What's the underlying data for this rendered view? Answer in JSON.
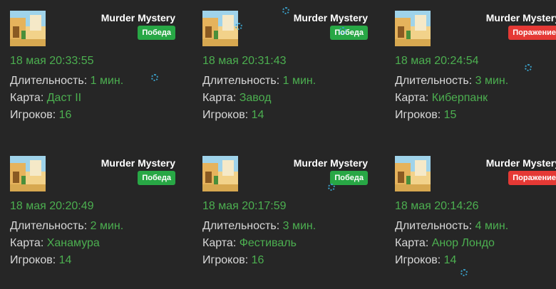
{
  "cards": [
    {
      "game": "Murder Mystery",
      "result": "Победа",
      "result_kind": "win",
      "date": "18 мая 20:33:55",
      "duration_label": "Длительность:",
      "duration": "1 мин.",
      "map_label": "Карта:",
      "map": "Даст II",
      "players_label": "Игроков:",
      "players": "16"
    },
    {
      "game": "Murder Mystery",
      "result": "Победа",
      "result_kind": "win",
      "date": "18 мая 20:31:43",
      "duration_label": "Длительность:",
      "duration": "1 мин.",
      "map_label": "Карта:",
      "map": "Завод",
      "players_label": "Игроков:",
      "players": "14"
    },
    {
      "game": "Murder Mystery",
      "result": "Поражение",
      "result_kind": "lose",
      "date": "18 мая 20:24:54",
      "duration_label": "Длительность:",
      "duration": "3 мин.",
      "map_label": "Карта:",
      "map": "Киберпанк",
      "players_label": "Игроков:",
      "players": "15"
    },
    {
      "game": "Murder Mystery",
      "result": "Победа",
      "result_kind": "win",
      "date": "18 мая 20:20:49",
      "duration_label": "Длительность:",
      "duration": "2 мин.",
      "map_label": "Карта:",
      "map": "Ханамура",
      "players_label": "Игроков:",
      "players": "14"
    },
    {
      "game": "Murder Mystery",
      "result": "Победа",
      "result_kind": "win",
      "date": "18 мая 20:17:59",
      "duration_label": "Длительность:",
      "duration": "3 мин.",
      "map_label": "Карта:",
      "map": "Фестиваль",
      "players_label": "Игроков:",
      "players": "16"
    },
    {
      "game": "Murder Mystery",
      "result": "Поражение",
      "result_kind": "lose",
      "date": "18 мая 20:14:26",
      "duration_label": "Длительность:",
      "duration": "4 мин.",
      "map_label": "Карта:",
      "map": "Анор Лондо",
      "players_label": "Игроков:",
      "players": "14"
    }
  ],
  "colors": {
    "background": "#262626",
    "accent_green": "#4caf50",
    "win_badge": "#28a745",
    "lose_badge": "#e53935"
  }
}
